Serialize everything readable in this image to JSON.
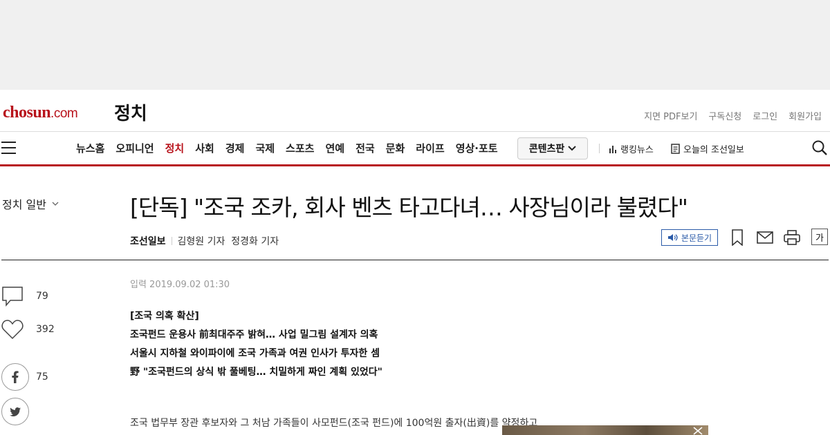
{
  "header": {
    "logo_main": "chosun",
    "logo_dotcom": ".com",
    "section_title": "정치",
    "util_links": [
      "지면 PDF보기",
      "구독신청",
      "로그인",
      "회원가입"
    ]
  },
  "nav": {
    "items": [
      "뉴스홈",
      "오피니언",
      "정치",
      "사회",
      "경제",
      "국제",
      "스포츠",
      "연예",
      "전국",
      "문화",
      "라이프",
      "영상·포토"
    ],
    "active": "정치",
    "contents_label": "콘텐츠판",
    "ranking_label": "랭킹뉴스",
    "today_label": "오늘의 조선일보"
  },
  "category": {
    "label": "정치 일반"
  },
  "article": {
    "headline": "[단독] \"조국 조카, 회사 벤츠 타고다녀… 사장님이라 불렸다\"",
    "press": "조선일보",
    "reporters": "김형원 기자  정경화 기자",
    "listen_label": "본문듣기",
    "font_label": "가",
    "date": "입력 2019.09.02 01:30",
    "summary": [
      "[조국 의혹 확산]",
      "조국펀드 운용사 前최대주주 밝혀… 사업 밀그림 설계자 의혹",
      "서울시 지하철 와이파이에 조국 가족과 여권 인사가 투자한 셈",
      "野 \"조국펀드의 상식 밖 풀베팅… 치밀하게 짜인 계획 있었다\""
    ],
    "body_first_line": "조국 법무부 장관 후보자와 그 처남 가족들이 사모펀드(조국 펀드)에 100억원 출자(出資)를 약정하고"
  },
  "side": {
    "comments": "79",
    "likes": "392",
    "facebook": "75"
  },
  "colors": {
    "brand": "#b8121b",
    "listen": "#2a5aa8"
  }
}
